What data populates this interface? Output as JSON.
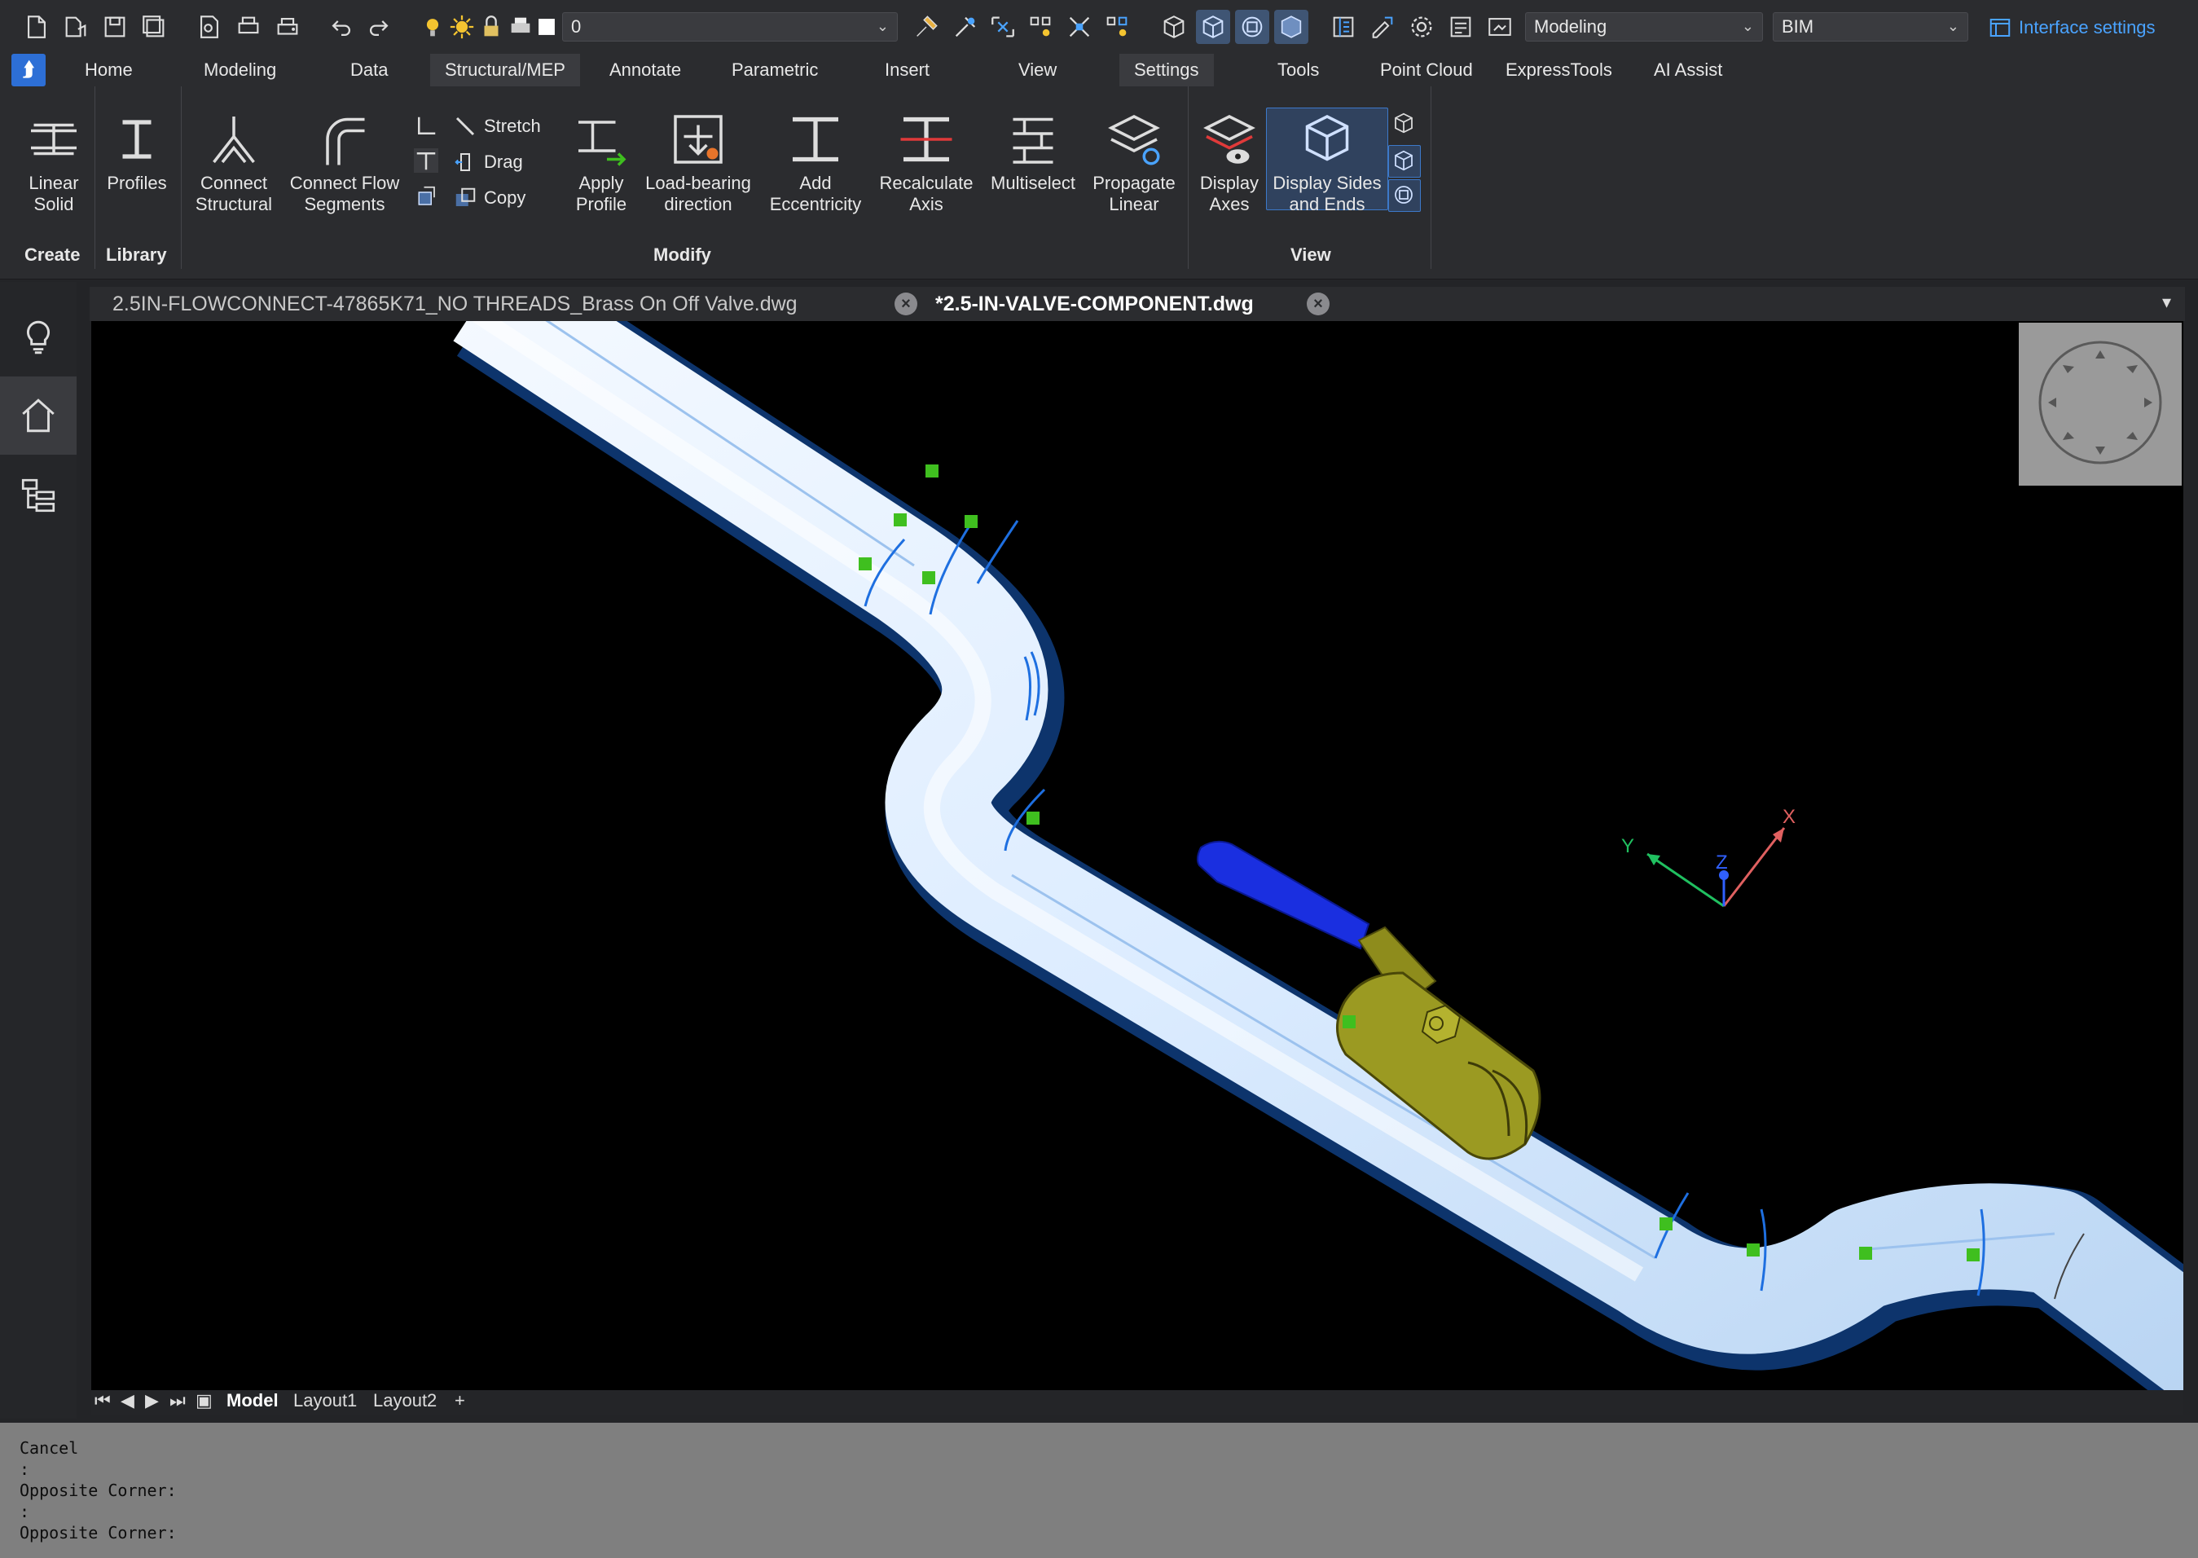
{
  "quick_access": {
    "layer_value": "0",
    "workspace": "Modeling",
    "discipline": "BIM",
    "interface_settings": "Interface settings"
  },
  "ribbon_tabs": [
    "Home",
    "Modeling",
    "Data",
    "Structural/MEP",
    "Annotate",
    "Parametric",
    "Insert",
    "View",
    "Settings",
    "Tools",
    "Point Cloud",
    "ExpressTools",
    "AI Assist"
  ],
  "ribbon": {
    "create": {
      "title": "Create",
      "linear_solid": "Linear\nSolid"
    },
    "library": {
      "title": "Library",
      "profiles": "Profiles"
    },
    "modify": {
      "title": "Modify",
      "connect_structural": "Connect\nStructural",
      "connect_flow_segments": "Connect Flow\nSegments",
      "stretch": "Stretch",
      "drag": "Drag",
      "copy": "Copy",
      "apply_profile": "Apply\nProfile",
      "load_bearing_direction": "Load-bearing\ndirection",
      "add_eccentricity": "Add\nEccentricity",
      "recalculate_axis": "Recalculate\nAxis",
      "multiselect": "Multiselect",
      "propagate_linear": "Propagate\nLinear"
    },
    "view": {
      "title": "View",
      "display_axes": "Display\nAxes",
      "display_sides_and_ends": "Display Sides\nand Ends"
    }
  },
  "document_tabs": [
    {
      "label": "2.5IN-FLOWCONNECT-47865K71_NO THREADS_Brass On Off Valve.dwg",
      "active": false
    },
    {
      "label": "*2.5-IN-VALVE-COMPONENT.dwg",
      "active": true
    }
  ],
  "ucs": {
    "x": "X",
    "y": "Y",
    "z": "Z"
  },
  "layout_tabs": [
    "Model",
    "Layout1",
    "Layout2",
    "+"
  ],
  "command_history": [
    "Cancel",
    ":",
    "Opposite Corner:",
    ":",
    "Opposite Corner:"
  ],
  "colors": {
    "accent": "#4aa3ff",
    "pipe": "#dfeeff",
    "valve_handle": "#1a2fe0",
    "valve_body": "#9b9a22",
    "grip": "#3fbf1f"
  }
}
